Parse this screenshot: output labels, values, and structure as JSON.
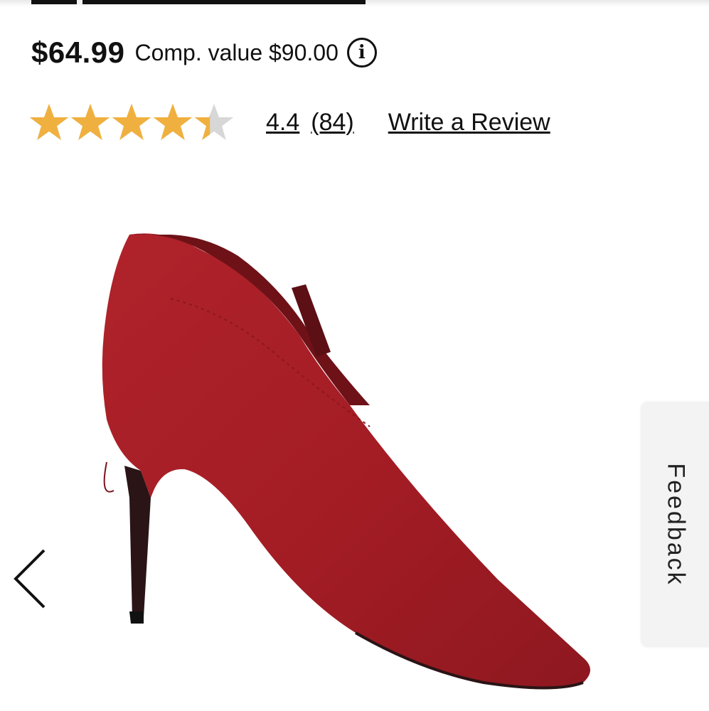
{
  "pricing": {
    "price": "$64.99",
    "comp_value": "Comp. value $90.00",
    "info_icon": "info-icon"
  },
  "rating": {
    "value": 4.4,
    "max": 5,
    "value_label": "4.4",
    "count_label": "(84)",
    "write_review_label": "Write a Review",
    "star_filled_color": "#f0b03f",
    "star_empty_color": "#d7d7d7"
  },
  "gallery": {
    "prev_icon": "chevron-left-icon",
    "next_icon": "chevron-right-icon",
    "product_color": "#a31c24"
  },
  "feedback": {
    "label": "Feedback"
  }
}
